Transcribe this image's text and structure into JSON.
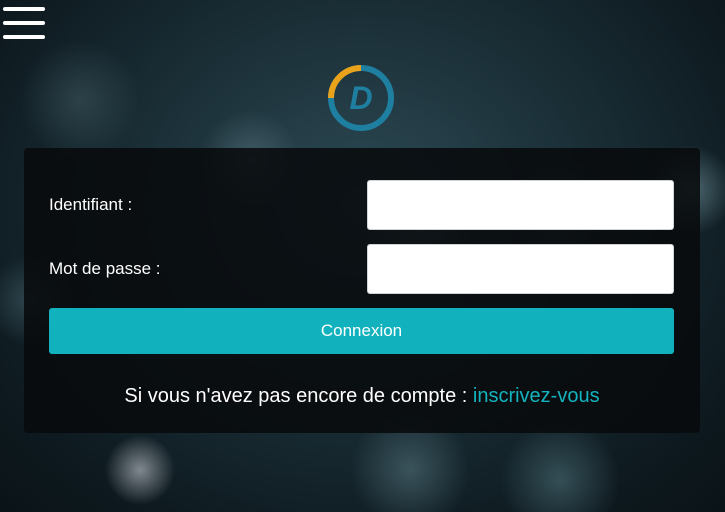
{
  "menu": {
    "icon": "hamburger-menu-icon"
  },
  "logo": {
    "letter": "D",
    "ring_color_1": "#e9a21a",
    "ring_color_2": "#1f7fa0",
    "icon": "d-logo-icon"
  },
  "form": {
    "username_label": "Identifiant :",
    "username_value": "",
    "password_label": "Mot de passe :",
    "password_value": "",
    "submit_label": "Connexion",
    "accent_color": "#11b2bd"
  },
  "signup": {
    "prompt": "Si vous n'avez pas encore de compte : ",
    "link_label": "inscrivez-vous"
  }
}
